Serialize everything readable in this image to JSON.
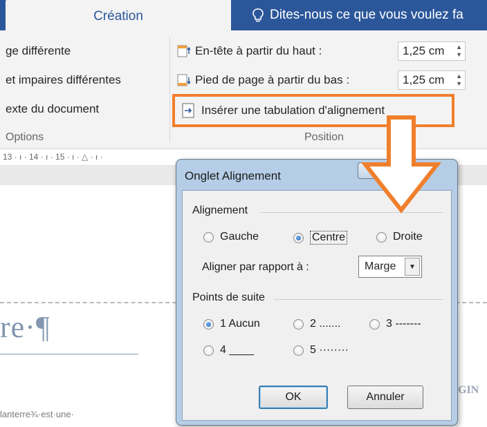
{
  "colors": {
    "accent": "#2b579a",
    "highlight": "#f07f2c",
    "dialog_frame": "#b5cde6"
  },
  "ribbon_tabs": {
    "active": "Création",
    "tell_me": "Dites-nous ce que vous voulez fa",
    "tell_me_icon": "lightbulb-icon"
  },
  "options_group": {
    "items": [
      "ge différente",
      "et impaires différentes",
      "exte du document"
    ],
    "label": "Options"
  },
  "position_group": {
    "header_label": "En-tête à partir du haut :",
    "header_value": "1,25 cm",
    "footer_label": "Pied de page à partir du bas :",
    "footer_value": "1,25 cm",
    "insert_tab_label": "Insérer une tabulation d'alignement",
    "label": "Position"
  },
  "ruler": {
    "text": "13 · ı · 14 · ı · 15 · ı · △ · ı ·"
  },
  "document": {
    "title_fragment": "re·¶",
    "body_fragment": "lanterre¾·est·une·",
    "right_fragment": "GIN"
  },
  "dialog": {
    "title": "Onglet Alignement",
    "help_label": "?",
    "close_label": "✕",
    "alignment_section": "Alignement",
    "alignment_options": [
      "Gauche",
      "Centre",
      "Droite"
    ],
    "alignment_selected": "Centre",
    "align_relative_label": "Aligner par rapport à :",
    "align_relative_value": "Marge",
    "leader_section": "Points de suite",
    "leader_options": [
      "1 Aucun",
      "2 .......",
      "3 -------",
      "4 ____",
      "5 ········"
    ],
    "leader_selected": "1 Aucun",
    "ok_label": "OK",
    "cancel_label": "Annuler"
  }
}
